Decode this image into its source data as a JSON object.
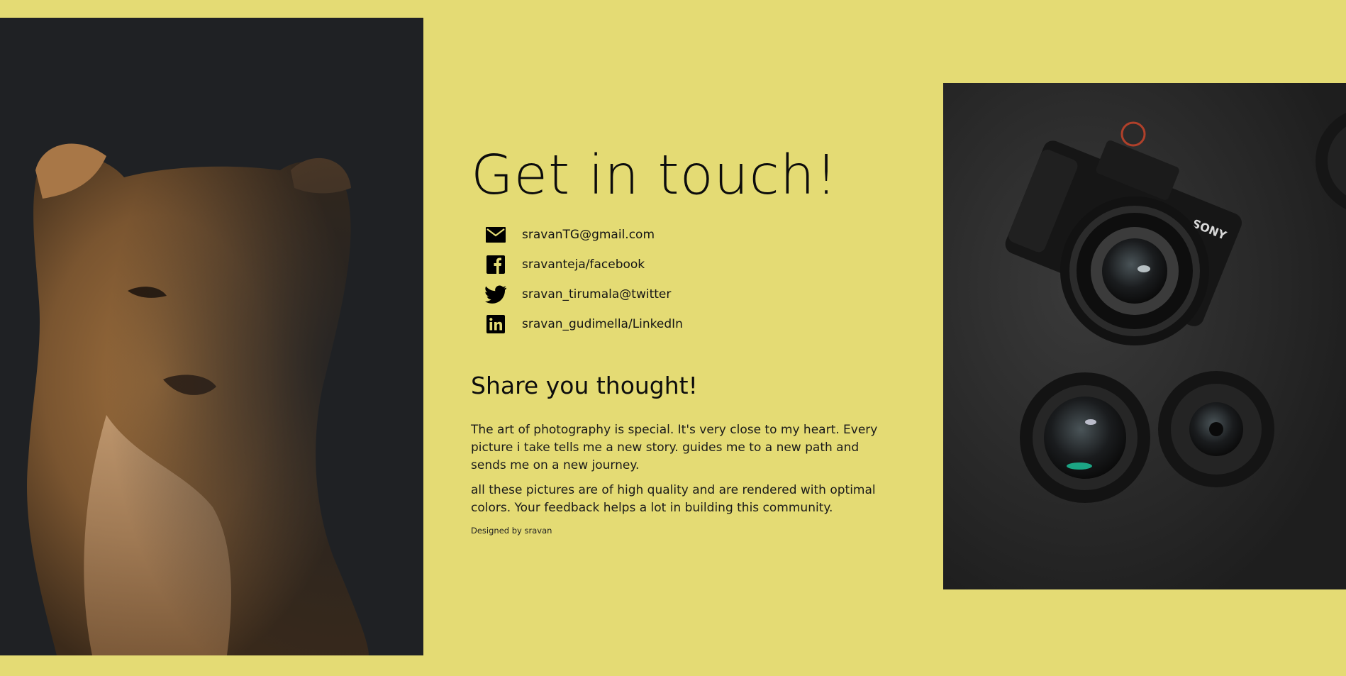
{
  "hero": {
    "title": "Get in touch!"
  },
  "contacts": [
    {
      "icon": "mail-icon",
      "label": "sravanTG@gmail.com"
    },
    {
      "icon": "facebook-icon",
      "label": "sravanteja/facebook"
    },
    {
      "icon": "twitter-icon",
      "label": "sravan_tirumala@twitter"
    },
    {
      "icon": "linkedin-icon",
      "label": "sravan_gudimella/LinkedIn"
    }
  ],
  "share": {
    "title": "Share you thought!",
    "paragraph_1": "The art of photography is special. It's very close to my heart. Every picture i take tells me a new story. guides me to a new path and sends me on a new journey.",
    "paragraph_2": "all these pictures are of high quality and are rendered with optimal colors. Your feedback helps a lot in building this community.",
    "credit": "Designed by sravan"
  },
  "colors": {
    "background": "#e4db74",
    "photo_dark": "#1f2124",
    "text": "#111111"
  }
}
